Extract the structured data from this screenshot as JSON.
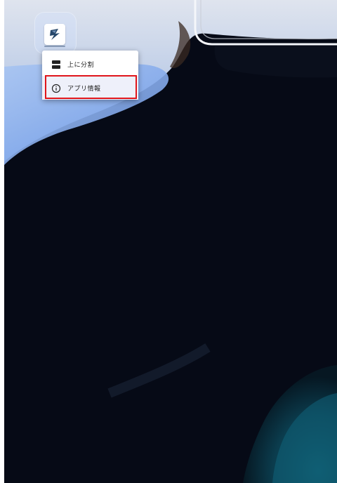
{
  "app_icon": {
    "name": "app-shortcut",
    "icon": "stylized-s-logo"
  },
  "context_menu": {
    "items": [
      {
        "label": "上に分割",
        "icon": "split-screen-top-icon"
      },
      {
        "label": "アプリ情報",
        "icon": "info-icon"
      }
    ],
    "highlighted_item": "アプリ情報",
    "highlight_color": "#e0151b"
  }
}
